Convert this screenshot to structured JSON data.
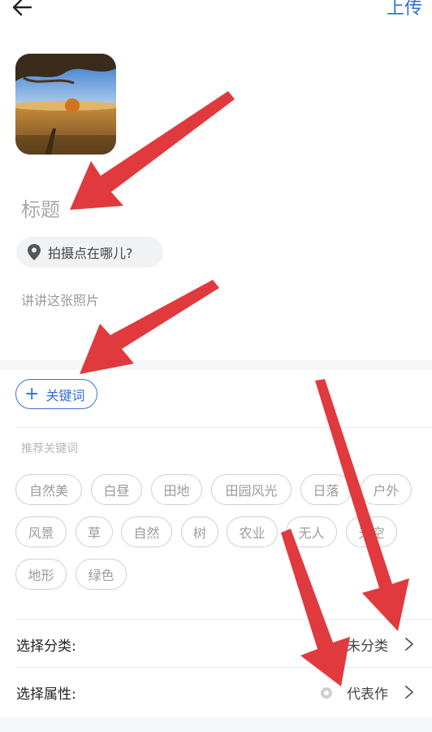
{
  "header": {
    "back_icon": "back-arrow-icon",
    "upload_label": "上传"
  },
  "photo": {
    "alt": "风景照片"
  },
  "form": {
    "title_placeholder": "标题",
    "location_placeholder": "拍摄点在哪儿?",
    "description_placeholder": "讲讲这张照片"
  },
  "keywords": {
    "add_label": "关键词",
    "recommended_label": "推荐关键词",
    "rows": [
      [
        "自然美",
        "白昼",
        "田地",
        "田园风光",
        "日落",
        "户外"
      ],
      [
        "风景",
        "草",
        "自然",
        "树",
        "农业",
        "无人",
        "天空"
      ],
      [
        "地形",
        "绿色"
      ]
    ]
  },
  "settings": {
    "category_label": "选择分类:",
    "category_value": "未分类",
    "attribute_label": "选择属性:",
    "attribute_value": "代表作"
  },
  "colors": {
    "accent": "#2f6fd6",
    "annotation_arrow": "#e03a3e"
  }
}
